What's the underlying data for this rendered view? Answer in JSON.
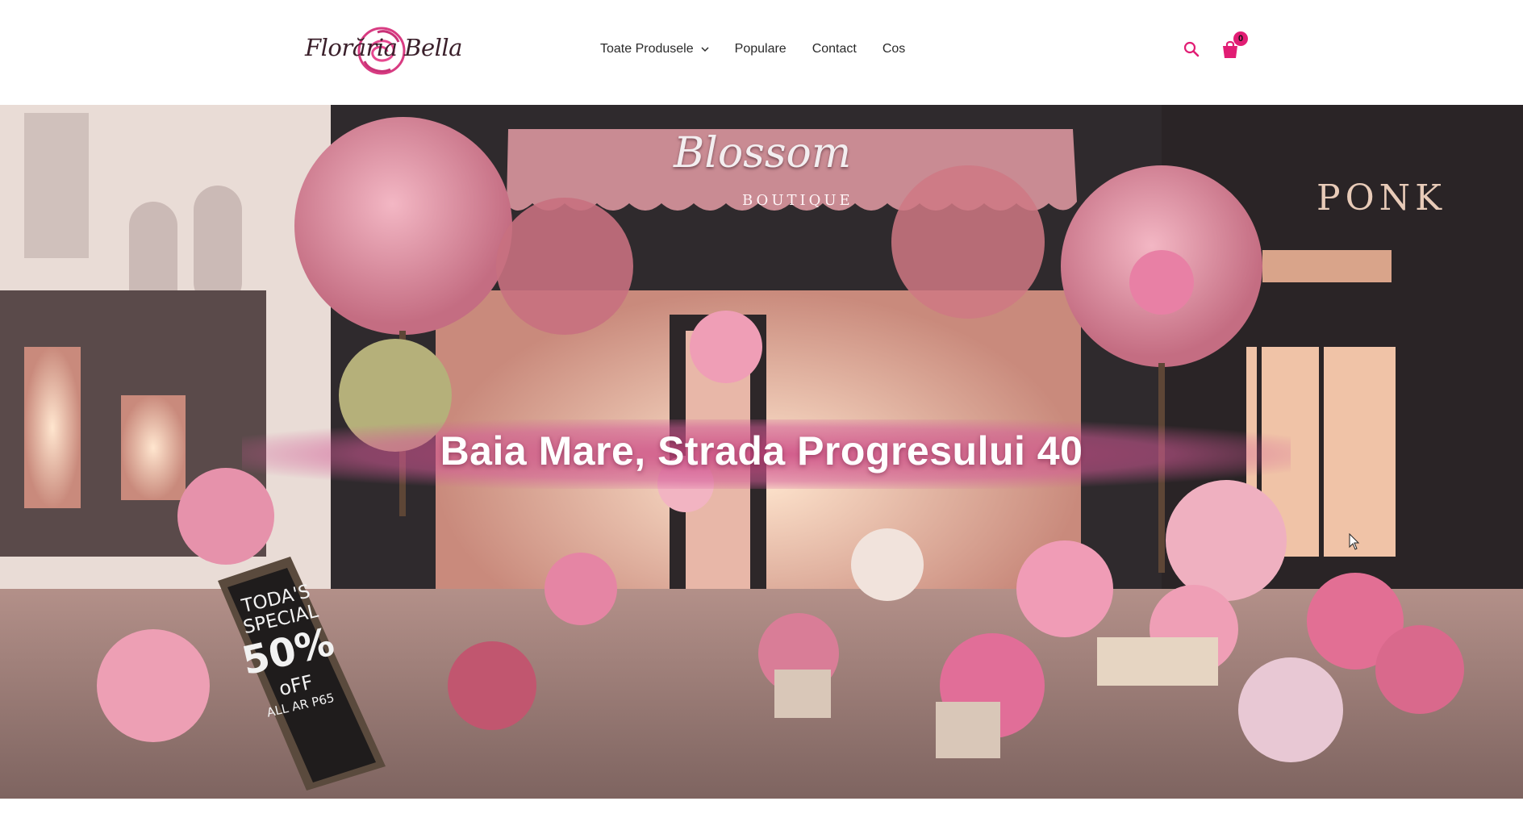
{
  "header": {
    "logo_text": "Florăria Bella",
    "nav": [
      {
        "label": "Toate Produsele",
        "has_dropdown": true
      },
      {
        "label": "Populare"
      },
      {
        "label": "Contact"
      },
      {
        "label": "Cos"
      }
    ],
    "cart_count": "0"
  },
  "hero": {
    "title": "Baia Mare, Strada Progresului 40",
    "sign_main": "Blossom",
    "sign_sub": "BOUTIQUE",
    "sign_right": "PONK",
    "chalkboard": {
      "line1": "TODA'S SPECIAL",
      "line2": "50%",
      "line3": "oFF",
      "line4": "ALL AR P65"
    }
  },
  "colors": {
    "accent": "#e11d74",
    "hero_band": "#cb4782",
    "text_dark": "#2a2a2a"
  }
}
